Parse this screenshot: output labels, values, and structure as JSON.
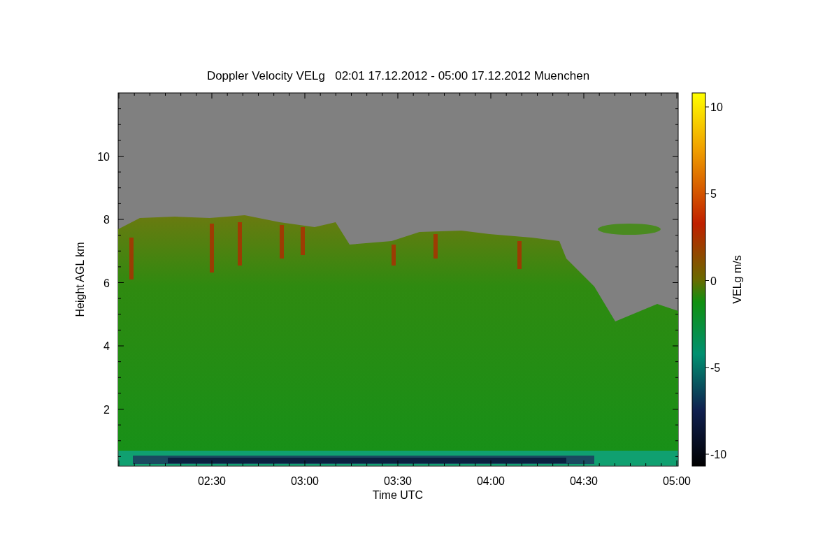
{
  "title": "Doppler Velocity VELg   02:01 17.12.2012 - 05:00 17.12.2012 Muenchen",
  "plot": {
    "ylabel": "Height AGL km",
    "xlabel": "Time UTC",
    "yticks": [
      "10",
      "8",
      "6",
      "4",
      "2"
    ],
    "xticks": [
      "02:30",
      "03:00",
      "03:30",
      "04:00",
      "04:30",
      "05:00"
    ]
  },
  "colorbar": {
    "label": "VELg m/s",
    "ticks": [
      "10",
      "5",
      "0",
      "-5",
      "-10"
    ]
  }
}
